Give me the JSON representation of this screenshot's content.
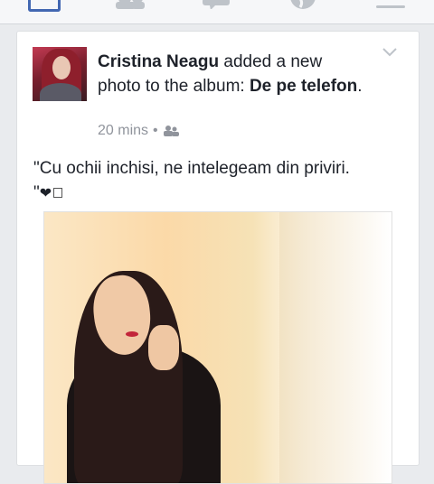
{
  "post": {
    "author": "Cristina Neagu",
    "action_text": "added a new photo to the album:",
    "album": "De pe telefon",
    "period": ".",
    "time": "20 mins",
    "dot": "•",
    "caption_line1": "\"Cu ochii inchisi, ne intelegeam din priviri.",
    "caption_line2": "\""
  },
  "icons": {
    "nav": [
      "home-icon",
      "friends-icon",
      "messages-icon",
      "globe-icon",
      "menu-icon"
    ],
    "audience": "friends-audience-icon",
    "options": "chevron-down-icon",
    "heart": "heart-icon"
  },
  "colors": {
    "brand": "#4267b2",
    "text": "#1d2129",
    "meta": "#90949c",
    "background": "#e9ebee"
  }
}
